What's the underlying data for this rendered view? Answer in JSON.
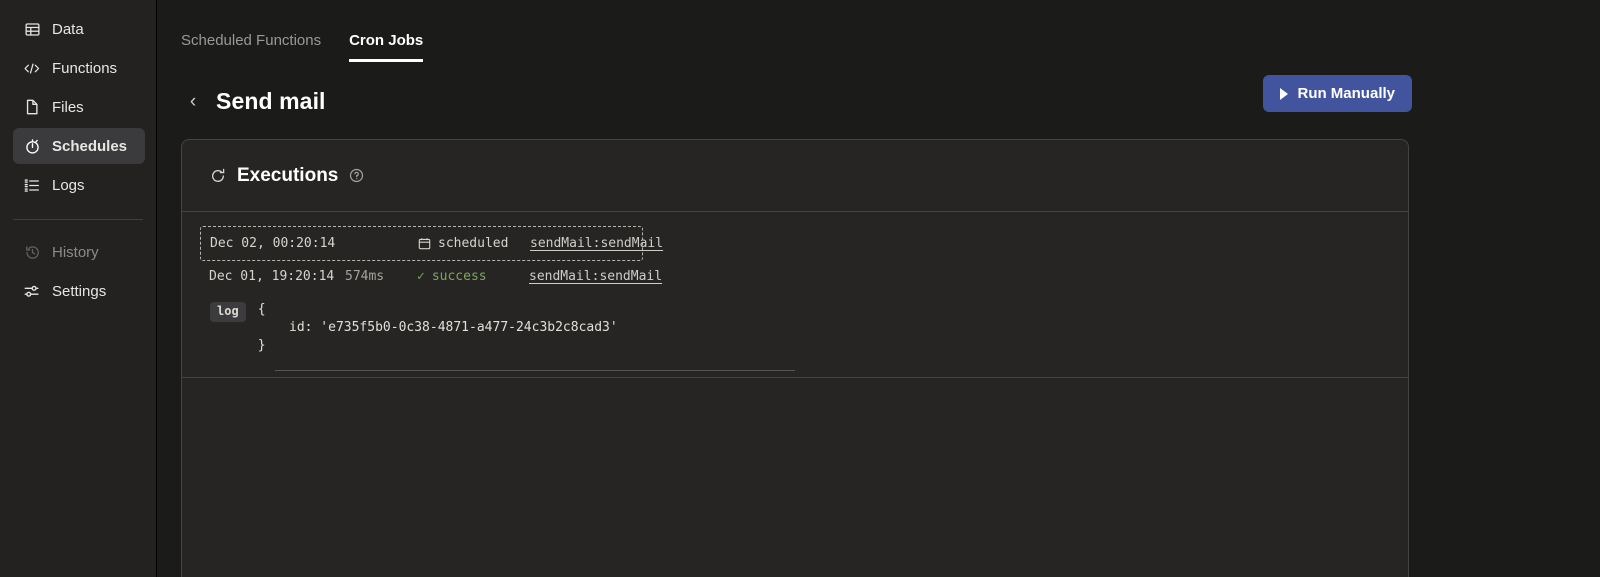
{
  "sidebar": {
    "items": [
      {
        "label": "Data",
        "icon": "table-icon",
        "state": "normal"
      },
      {
        "label": "Functions",
        "icon": "code-icon",
        "state": "normal"
      },
      {
        "label": "Files",
        "icon": "file-icon",
        "state": "normal"
      },
      {
        "label": "Schedules",
        "icon": "stopwatch-icon",
        "state": "active"
      },
      {
        "label": "Logs",
        "icon": "list-icon",
        "state": "normal"
      }
    ],
    "secondary": [
      {
        "label": "History",
        "icon": "history-icon",
        "state": "dim"
      },
      {
        "label": "Settings",
        "icon": "settings-icon",
        "state": "normal"
      }
    ]
  },
  "tabs": [
    {
      "label": "Scheduled Functions",
      "active": false
    },
    {
      "label": "Cron Jobs",
      "active": true
    }
  ],
  "header": {
    "back_label": "‹",
    "title": "Send mail",
    "run_button": "Run Manually"
  },
  "panel": {
    "title": "Executions",
    "refresh_icon": "refresh-icon",
    "help_icon": "help-circle-icon"
  },
  "executions": [
    {
      "date": "Dec 02, 00:20:14",
      "duration": "",
      "status": "scheduled",
      "status_icon": "calendar-icon",
      "function": "sendMail:sendMail",
      "selected": true
    },
    {
      "date": "Dec 01, 19:20:14",
      "duration": "574ms",
      "status": "success",
      "status_icon": "check-icon",
      "function": "sendMail:sendMail",
      "selected": false
    }
  ],
  "log": {
    "badge": "log",
    "body": "{\n    id: 'e735f5b0-0c38-4871-a477-24c3b2c8cad3'\n}"
  },
  "colors": {
    "accent": "#41549d",
    "success": "#7aa95c",
    "panel_bg": "#262523",
    "sidebar_bg": "#232220",
    "page_bg": "#1b1b1a"
  }
}
